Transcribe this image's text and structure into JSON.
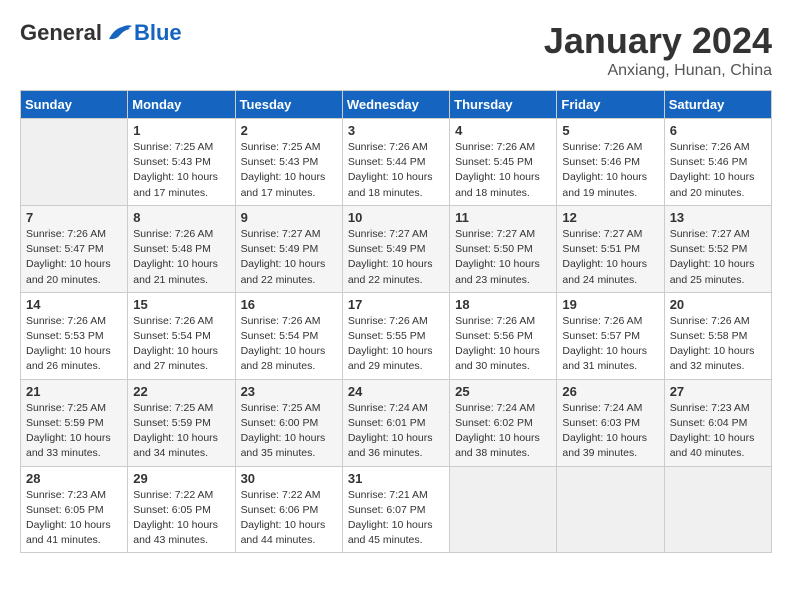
{
  "header": {
    "logo_general": "General",
    "logo_blue": "Blue",
    "month_title": "January 2024",
    "location": "Anxiang, Hunan, China"
  },
  "calendar": {
    "days_of_week": [
      "Sunday",
      "Monday",
      "Tuesday",
      "Wednesday",
      "Thursday",
      "Friday",
      "Saturday"
    ],
    "weeks": [
      {
        "days": [
          {
            "number": "",
            "info": ""
          },
          {
            "number": "1",
            "info": "Sunrise: 7:25 AM\nSunset: 5:43 PM\nDaylight: 10 hours\nand 17 minutes."
          },
          {
            "number": "2",
            "info": "Sunrise: 7:25 AM\nSunset: 5:43 PM\nDaylight: 10 hours\nand 17 minutes."
          },
          {
            "number": "3",
            "info": "Sunrise: 7:26 AM\nSunset: 5:44 PM\nDaylight: 10 hours\nand 18 minutes."
          },
          {
            "number": "4",
            "info": "Sunrise: 7:26 AM\nSunset: 5:45 PM\nDaylight: 10 hours\nand 18 minutes."
          },
          {
            "number": "5",
            "info": "Sunrise: 7:26 AM\nSunset: 5:46 PM\nDaylight: 10 hours\nand 19 minutes."
          },
          {
            "number": "6",
            "info": "Sunrise: 7:26 AM\nSunset: 5:46 PM\nDaylight: 10 hours\nand 20 minutes."
          }
        ]
      },
      {
        "days": [
          {
            "number": "7",
            "info": "Sunrise: 7:26 AM\nSunset: 5:47 PM\nDaylight: 10 hours\nand 20 minutes."
          },
          {
            "number": "8",
            "info": "Sunrise: 7:26 AM\nSunset: 5:48 PM\nDaylight: 10 hours\nand 21 minutes."
          },
          {
            "number": "9",
            "info": "Sunrise: 7:27 AM\nSunset: 5:49 PM\nDaylight: 10 hours\nand 22 minutes."
          },
          {
            "number": "10",
            "info": "Sunrise: 7:27 AM\nSunset: 5:49 PM\nDaylight: 10 hours\nand 22 minutes."
          },
          {
            "number": "11",
            "info": "Sunrise: 7:27 AM\nSunset: 5:50 PM\nDaylight: 10 hours\nand 23 minutes."
          },
          {
            "number": "12",
            "info": "Sunrise: 7:27 AM\nSunset: 5:51 PM\nDaylight: 10 hours\nand 24 minutes."
          },
          {
            "number": "13",
            "info": "Sunrise: 7:27 AM\nSunset: 5:52 PM\nDaylight: 10 hours\nand 25 minutes."
          }
        ]
      },
      {
        "days": [
          {
            "number": "14",
            "info": "Sunrise: 7:26 AM\nSunset: 5:53 PM\nDaylight: 10 hours\nand 26 minutes."
          },
          {
            "number": "15",
            "info": "Sunrise: 7:26 AM\nSunset: 5:54 PM\nDaylight: 10 hours\nand 27 minutes."
          },
          {
            "number": "16",
            "info": "Sunrise: 7:26 AM\nSunset: 5:54 PM\nDaylight: 10 hours\nand 28 minutes."
          },
          {
            "number": "17",
            "info": "Sunrise: 7:26 AM\nSunset: 5:55 PM\nDaylight: 10 hours\nand 29 minutes."
          },
          {
            "number": "18",
            "info": "Sunrise: 7:26 AM\nSunset: 5:56 PM\nDaylight: 10 hours\nand 30 minutes."
          },
          {
            "number": "19",
            "info": "Sunrise: 7:26 AM\nSunset: 5:57 PM\nDaylight: 10 hours\nand 31 minutes."
          },
          {
            "number": "20",
            "info": "Sunrise: 7:26 AM\nSunset: 5:58 PM\nDaylight: 10 hours\nand 32 minutes."
          }
        ]
      },
      {
        "days": [
          {
            "number": "21",
            "info": "Sunrise: 7:25 AM\nSunset: 5:59 PM\nDaylight: 10 hours\nand 33 minutes."
          },
          {
            "number": "22",
            "info": "Sunrise: 7:25 AM\nSunset: 5:59 PM\nDaylight: 10 hours\nand 34 minutes."
          },
          {
            "number": "23",
            "info": "Sunrise: 7:25 AM\nSunset: 6:00 PM\nDaylight: 10 hours\nand 35 minutes."
          },
          {
            "number": "24",
            "info": "Sunrise: 7:24 AM\nSunset: 6:01 PM\nDaylight: 10 hours\nand 36 minutes."
          },
          {
            "number": "25",
            "info": "Sunrise: 7:24 AM\nSunset: 6:02 PM\nDaylight: 10 hours\nand 38 minutes."
          },
          {
            "number": "26",
            "info": "Sunrise: 7:24 AM\nSunset: 6:03 PM\nDaylight: 10 hours\nand 39 minutes."
          },
          {
            "number": "27",
            "info": "Sunrise: 7:23 AM\nSunset: 6:04 PM\nDaylight: 10 hours\nand 40 minutes."
          }
        ]
      },
      {
        "days": [
          {
            "number": "28",
            "info": "Sunrise: 7:23 AM\nSunset: 6:05 PM\nDaylight: 10 hours\nand 41 minutes."
          },
          {
            "number": "29",
            "info": "Sunrise: 7:22 AM\nSunset: 6:05 PM\nDaylight: 10 hours\nand 43 minutes."
          },
          {
            "number": "30",
            "info": "Sunrise: 7:22 AM\nSunset: 6:06 PM\nDaylight: 10 hours\nand 44 minutes."
          },
          {
            "number": "31",
            "info": "Sunrise: 7:21 AM\nSunset: 6:07 PM\nDaylight: 10 hours\nand 45 minutes."
          },
          {
            "number": "",
            "info": ""
          },
          {
            "number": "",
            "info": ""
          },
          {
            "number": "",
            "info": ""
          }
        ]
      }
    ]
  }
}
